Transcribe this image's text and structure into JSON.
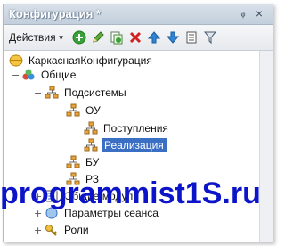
{
  "window": {
    "title": "Конфигурация *",
    "pin_glyph": "ᵩ",
    "close_glyph": "×"
  },
  "toolbar": {
    "actions_label": "Действия",
    "buttons": [
      {
        "name": "add-button",
        "icon": "add-icon"
      },
      {
        "name": "edit-button",
        "icon": "pencil-icon"
      },
      {
        "name": "copy-button",
        "icon": "copy-icon"
      },
      {
        "name": "delete-button",
        "icon": "delete-icon"
      },
      {
        "name": "move-up-button",
        "icon": "arrow-up-icon"
      },
      {
        "name": "move-down-button",
        "icon": "arrow-down-icon"
      },
      {
        "name": "list-button",
        "icon": "list-icon"
      },
      {
        "name": "filter-button",
        "icon": "filter-icon"
      }
    ]
  },
  "tree": {
    "root": "КаркаснаяКонфигурация",
    "common": "Общие",
    "subsystems": "Подсистемы",
    "ou": "ОУ",
    "postupleniya": "Поступления",
    "realizaciya": "Реализация",
    "bu": "БУ",
    "rz": "РЗ",
    "common_modules": "Общие модули",
    "session_params": "Параметры сеанса",
    "roles": "Роли"
  },
  "colors": {
    "selection": "#3a6fc4",
    "watermark": "#0b14c8"
  },
  "watermark": "programmist1S.ru"
}
